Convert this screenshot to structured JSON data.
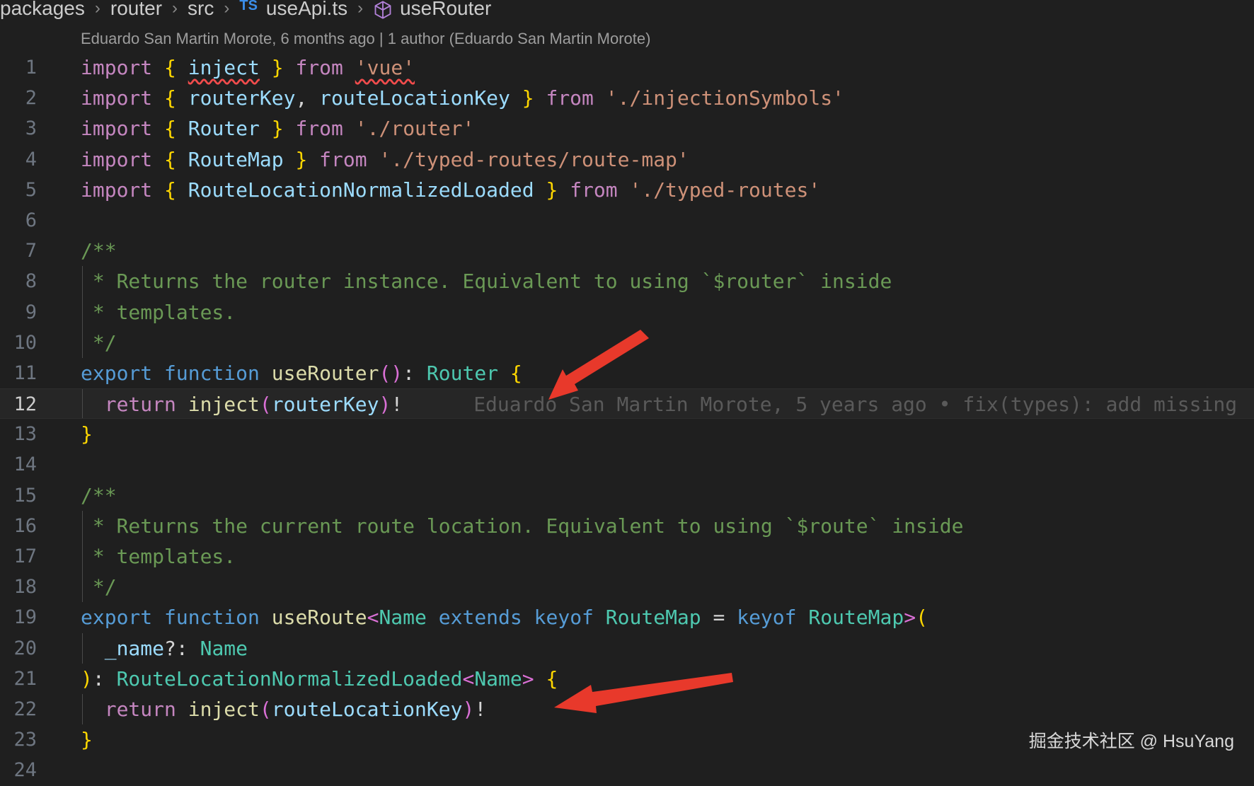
{
  "breadcrumb": {
    "items": [
      "packages",
      "router",
      "src",
      "useApi.ts",
      "useRouter"
    ],
    "ts_badge": "TS",
    "separator": "›"
  },
  "codelens": "Eduardo San Martin Morote, 6 months ago | 1 author (Eduardo San Martin Morote)",
  "editor": {
    "current_line": 12,
    "line_numbers": [
      "1",
      "2",
      "3",
      "4",
      "5",
      "6",
      "7",
      "8",
      "9",
      "10",
      "11",
      "12",
      "13",
      "14",
      "15",
      "16",
      "17",
      "18",
      "19",
      "20",
      "21",
      "22",
      "23",
      "24"
    ],
    "inline_blame": "Eduardo San Martin Morote, 5 years ago • fix(types): add missing",
    "lines": [
      [
        [
          "kw",
          "import"
        ],
        [
          "pun",
          " "
        ],
        [
          "br1",
          "{"
        ],
        [
          "pun",
          " "
        ],
        [
          "var squig",
          "inject"
        ],
        [
          "pun",
          " "
        ],
        [
          "br1",
          "}"
        ],
        [
          "pun",
          " "
        ],
        [
          "kw",
          "from"
        ],
        [
          "pun",
          " "
        ],
        [
          "str squig",
          "'vue'"
        ]
      ],
      [
        [
          "kw",
          "import"
        ],
        [
          "pun",
          " "
        ],
        [
          "br1",
          "{"
        ],
        [
          "pun",
          " "
        ],
        [
          "var",
          "routerKey"
        ],
        [
          "pun",
          ", "
        ],
        [
          "var",
          "routeLocationKey"
        ],
        [
          "pun",
          " "
        ],
        [
          "br1",
          "}"
        ],
        [
          "pun",
          " "
        ],
        [
          "kw",
          "from"
        ],
        [
          "pun",
          " "
        ],
        [
          "str",
          "'./injectionSymbols'"
        ]
      ],
      [
        [
          "kw",
          "import"
        ],
        [
          "pun",
          " "
        ],
        [
          "br1",
          "{"
        ],
        [
          "pun",
          " "
        ],
        [
          "var",
          "Router"
        ],
        [
          "pun",
          " "
        ],
        [
          "br1",
          "}"
        ],
        [
          "pun",
          " "
        ],
        [
          "kw",
          "from"
        ],
        [
          "pun",
          " "
        ],
        [
          "str",
          "'./router'"
        ]
      ],
      [
        [
          "kw",
          "import"
        ],
        [
          "pun",
          " "
        ],
        [
          "br1",
          "{"
        ],
        [
          "pun",
          " "
        ],
        [
          "var",
          "RouteMap"
        ],
        [
          "pun",
          " "
        ],
        [
          "br1",
          "}"
        ],
        [
          "pun",
          " "
        ],
        [
          "kw",
          "from"
        ],
        [
          "pun",
          " "
        ],
        [
          "str",
          "'./typed-routes/route-map'"
        ]
      ],
      [
        [
          "kw",
          "import"
        ],
        [
          "pun",
          " "
        ],
        [
          "br1",
          "{"
        ],
        [
          "pun",
          " "
        ],
        [
          "var",
          "RouteLocationNormalizedLoaded"
        ],
        [
          "pun",
          " "
        ],
        [
          "br1",
          "}"
        ],
        [
          "pun",
          " "
        ],
        [
          "kw",
          "from"
        ],
        [
          "pun",
          " "
        ],
        [
          "str",
          "'./typed-routes'"
        ]
      ],
      [],
      [
        [
          "cm",
          "/**"
        ]
      ],
      [
        [
          "cm",
          " * Returns the router instance. Equivalent to using `$router` inside"
        ]
      ],
      [
        [
          "cm",
          " * templates."
        ]
      ],
      [
        [
          "cm",
          " */"
        ]
      ],
      [
        [
          "kw2",
          "export"
        ],
        [
          "pun",
          " "
        ],
        [
          "kw2",
          "function"
        ],
        [
          "pun",
          " "
        ],
        [
          "fn",
          "useRouter"
        ],
        [
          "br2",
          "()"
        ],
        [
          "pun",
          ": "
        ],
        [
          "ty",
          "Router"
        ],
        [
          "pun",
          " "
        ],
        [
          "br1",
          "{"
        ]
      ],
      [
        [
          "pun",
          "  "
        ],
        [
          "kw",
          "return"
        ],
        [
          "pun",
          " "
        ],
        [
          "fn",
          "inject"
        ],
        [
          "br2",
          "("
        ],
        [
          "var",
          "routerKey"
        ],
        [
          "br2",
          ")"
        ],
        [
          "pun",
          "!"
        ]
      ],
      [
        [
          "br1",
          "}"
        ]
      ],
      [],
      [
        [
          "cm",
          "/**"
        ]
      ],
      [
        [
          "cm",
          " * Returns the current route location. Equivalent to using `$route` inside"
        ]
      ],
      [
        [
          "cm",
          " * templates."
        ]
      ],
      [
        [
          "cm",
          " */"
        ]
      ],
      [
        [
          "kw2",
          "export"
        ],
        [
          "pun",
          " "
        ],
        [
          "kw2",
          "function"
        ],
        [
          "pun",
          " "
        ],
        [
          "fn",
          "useRoute"
        ],
        [
          "br2",
          "<"
        ],
        [
          "ty",
          "Name"
        ],
        [
          "pun",
          " "
        ],
        [
          "kw2",
          "extends"
        ],
        [
          "pun",
          " "
        ],
        [
          "kw2",
          "keyof"
        ],
        [
          "pun",
          " "
        ],
        [
          "ty",
          "RouteMap"
        ],
        [
          "pun",
          " = "
        ],
        [
          "kw2",
          "keyof"
        ],
        [
          "pun",
          " "
        ],
        [
          "ty",
          "RouteMap"
        ],
        [
          "br2",
          ">"
        ],
        [
          "br1",
          "("
        ]
      ],
      [
        [
          "pun",
          "  "
        ],
        [
          "var",
          "_name"
        ],
        [
          "pun",
          "?: "
        ],
        [
          "ty",
          "Name"
        ]
      ],
      [
        [
          "br1",
          ")"
        ],
        [
          "pun",
          ": "
        ],
        [
          "ty",
          "RouteLocationNormalizedLoaded"
        ],
        [
          "br2",
          "<"
        ],
        [
          "ty",
          "Name"
        ],
        [
          "br2",
          ">"
        ],
        [
          "pun",
          " "
        ],
        [
          "br1",
          "{"
        ]
      ],
      [
        [
          "pun",
          "  "
        ],
        [
          "kw",
          "return"
        ],
        [
          "pun",
          " "
        ],
        [
          "fn",
          "inject"
        ],
        [
          "br2",
          "("
        ],
        [
          "var",
          "routeLocationKey"
        ],
        [
          "br2",
          ")"
        ],
        [
          "pun",
          "!"
        ]
      ],
      [
        [
          "br1",
          "}"
        ]
      ],
      []
    ]
  },
  "watermark": "掘金技术社区 @ HsuYang",
  "colors": {
    "background": "#1f1f1f",
    "arrow": "#e8392b",
    "keyword": "#c586c0",
    "string": "#ce9178",
    "comment": "#6a9955",
    "type": "#4ec9b0"
  },
  "icons": [
    "ts-file-icon",
    "symbol-method-cube-icon",
    "chevron-right-icon",
    "red-arrow-annotation"
  ]
}
